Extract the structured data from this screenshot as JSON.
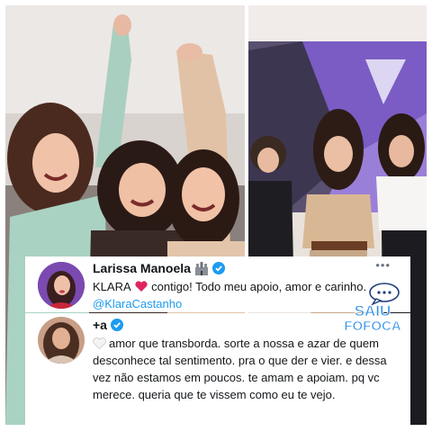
{
  "photos": {
    "left_alt_icon": "photo-three-girls",
    "right_alt_icon": "photo-three-women-dancing"
  },
  "tweets": [
    {
      "display_name": "Larissa Manoela",
      "badge_icon": "castle-icon",
      "verified_icon": "verified-badge-icon",
      "more_label": "•••",
      "text_before_heart": "KLARA",
      "heart_icon": "red-heart-icon",
      "text_after_heart": " contigo! Todo meu apoio, amor e carinho. ",
      "mention": "@KlaraCastanho"
    },
    {
      "display_name": "+a",
      "verified_icon": "verified-badge-icon",
      "heart_icon": "white-heart-icon",
      "text": "amor que transborda. sorte a nossa e azar de quem desconhece tal sentimento. pra o que der e vier. e dessa vez não estamos em poucos. te amam e apoiam. pq vc merece. queria que te vissem como eu te vejo."
    }
  ],
  "logo": {
    "line1": "SAIU",
    "line2": "FOFOCA",
    "bubble_icon": "speech-bubble-icon"
  },
  "colors": {
    "mention": "#1d9bf0",
    "verified": "#1d9bf0",
    "heart": "#e0245e",
    "logo_fill": "#2f8fe8"
  }
}
